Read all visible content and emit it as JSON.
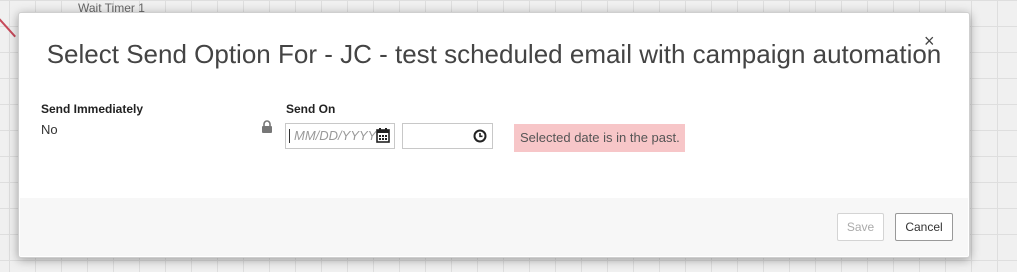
{
  "background": {
    "node_label": "Wait Timer 1"
  },
  "modal": {
    "title": "Select Send Option For - JC - test scheduled email with campaign automation",
    "close_label": "×",
    "send_immediately": {
      "label": "Send Immediately",
      "value": "No"
    },
    "send_on": {
      "label": "Send On",
      "date_placeholder": "MM/DD/YYYY",
      "time_value": ""
    },
    "error_message": "Selected date is in the past.",
    "footer": {
      "save_label": "Save",
      "cancel_label": "Cancel"
    }
  },
  "colors": {
    "error_bg": "#f7c6c8",
    "footer_bg": "#f7f7f7",
    "canvas_bg": "#f0f0f0"
  },
  "icons": [
    "lock-icon",
    "calendar-icon",
    "clock-icon",
    "close-icon"
  ]
}
